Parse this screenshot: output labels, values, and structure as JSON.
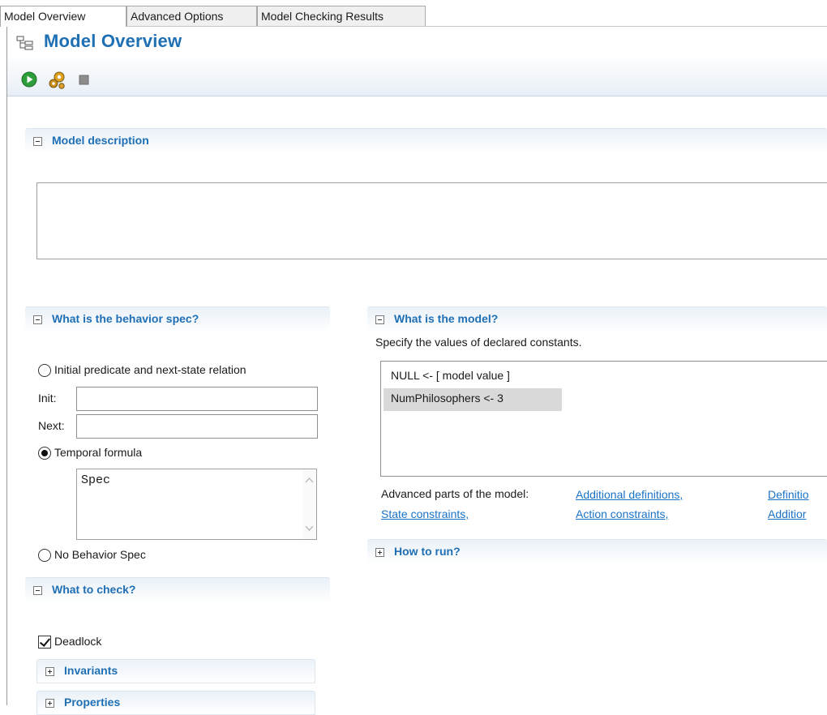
{
  "tabs": [
    {
      "label": "Model Overview",
      "active": true
    },
    {
      "label": "Advanced Options",
      "active": false
    },
    {
      "label": "Model Checking Results",
      "active": false
    }
  ],
  "header": {
    "title": "Model Overview",
    "title_icon": "model-overview-icon",
    "toolbar": [
      {
        "icon": "run-icon",
        "name": "run"
      },
      {
        "icon": "gears-icon",
        "name": "validate"
      },
      {
        "icon": "stop-icon",
        "name": "stop"
      }
    ]
  },
  "colors": {
    "title_blue": "#1f6fb4",
    "link_blue": "#1a73c8",
    "run_green": "#2e9e3b"
  },
  "model_description": {
    "title": "Model description",
    "text": ""
  },
  "behavior": {
    "title": "What is the behavior spec?",
    "option_init_next": "Initial predicate and next-state relation",
    "init_label": "Init:",
    "init_value": "",
    "next_label": "Next:",
    "next_value": "",
    "option_temporal": "Temporal formula",
    "temporal_value": "Spec",
    "option_none": "No Behavior Spec",
    "selected": "temporal"
  },
  "model": {
    "title": "What is the model?",
    "subtitle": "Specify the values of declared constants.",
    "constants": [
      {
        "text": "NULL <-  [ model value ]",
        "selected": false
      },
      {
        "text": "NumPhilosophers <- 3",
        "selected": true
      }
    ],
    "advanced_label": "Advanced parts of the model:",
    "links": {
      "additional_definitions": "Additional definitions,",
      "definition_override": "Definitio",
      "state_constraints": "State constraints,",
      "action_constraints": "Action constraints,",
      "additional_2": "Additior"
    }
  },
  "how_to_run": {
    "title": "How to run?"
  },
  "check": {
    "title": "What to check?",
    "deadlock_label": "Deadlock",
    "deadlock_checked": true,
    "invariants_title": "Invariants",
    "properties_title": "Properties"
  }
}
